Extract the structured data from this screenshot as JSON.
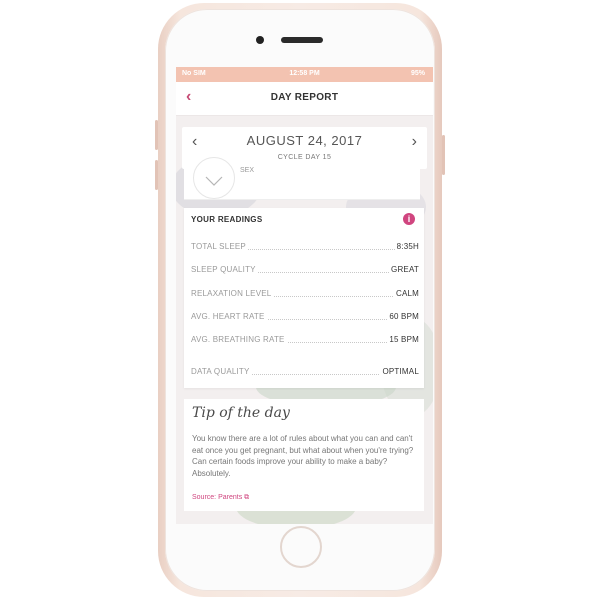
{
  "status_bar": {
    "carrier": "No SIM",
    "time": "12:58 PM",
    "battery": "95%"
  },
  "nav": {
    "back_icon": "chevron-left-icon",
    "title": "DAY REPORT"
  },
  "date_bar": {
    "prev_icon": "chevron-left-icon",
    "next_icon": "chevron-right-icon",
    "date": "AUGUST 24, 2017",
    "cycle_day": "CYCLE DAY 15"
  },
  "peek_card": {
    "partial_text": "SEX"
  },
  "readings": {
    "title": "YOUR READINGS",
    "info_icon": "info-icon",
    "rows": [
      {
        "label": "TOTAL SLEEP",
        "value": "8:35H"
      },
      {
        "label": "SLEEP QUALITY",
        "value": "GREAT"
      },
      {
        "label": "RELAXATION LEVEL",
        "value": "CALM"
      },
      {
        "label": "AVG. HEART RATE",
        "value": "60 BPM"
      },
      {
        "label": "AVG. BREATHING RATE",
        "value": "15 BPM"
      },
      {
        "label": "DATA QUALITY",
        "value": "OPTIMAL"
      }
    ]
  },
  "tip": {
    "title": "Tip of the day",
    "body": "You know there are a lot of rules about what you can and can't eat once you get pregnant, but what about when you're trying? Can certain foods improve your ability to make a baby? Absolutely.",
    "source": "Source: Parents ⧉"
  },
  "colors": {
    "accent": "#c64a74",
    "status_bar": "#f3c3b1",
    "phone": "#f2ddd3"
  }
}
